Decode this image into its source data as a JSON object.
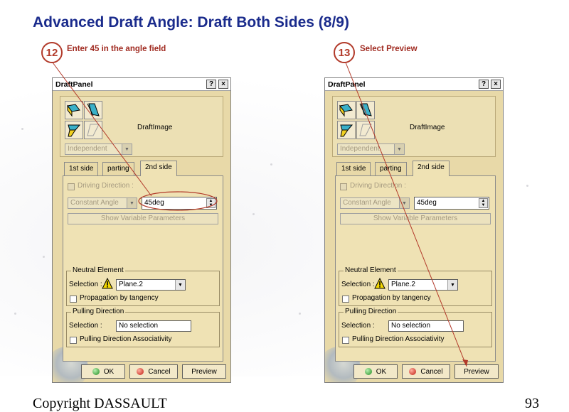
{
  "slide": {
    "title": "Advanced Draft Angle: Draft Both Sides (8/9)",
    "footer_left": "Copyright DASSAULT",
    "page_number": "93"
  },
  "steps": [
    {
      "number": "12",
      "text": "Enter 45 in the angle field"
    },
    {
      "number": "13",
      "text": "Select Preview"
    }
  ],
  "dialog": {
    "title": "DraftPanel",
    "help_button": "?",
    "close_button": "×",
    "image_label": "DraftImage",
    "mode_combo": "Independent",
    "tabs": [
      "1st side",
      "parting",
      "2nd side"
    ],
    "active_tab": "2nd side",
    "driving_direction_label": "Driving Direction :",
    "angle_type_combo": "Constant Angle",
    "angle_value": "45deg",
    "show_variable_parameters": "Show Variable Parameters",
    "neutral_element": {
      "title": "Neutral Element",
      "selection_label": "Selection :",
      "selection_value": "Plane.2",
      "propagation_label": "Propagation by tangency"
    },
    "pulling_direction": {
      "title": "Pulling Direction",
      "selection_label": "Selection :",
      "selection_value": "No selection",
      "associativity_label": "Pulling Direction Associativity"
    },
    "buttons": {
      "ok": "OK",
      "cancel": "Cancel",
      "preview": "Preview"
    }
  },
  "colors": {
    "title_blue": "#1a2b8c",
    "annotation_red": "#b23a2a",
    "dialog_bg": "#e8d9a8"
  }
}
